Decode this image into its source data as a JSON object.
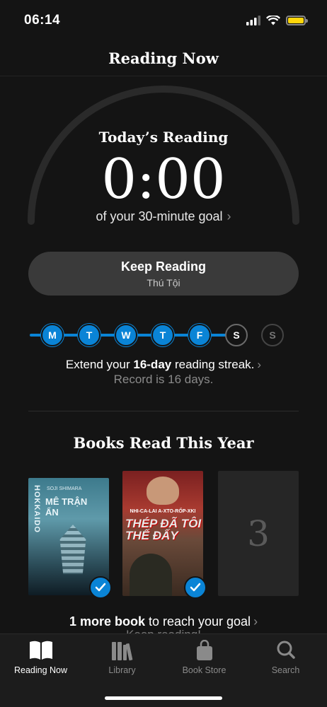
{
  "status": {
    "time": "06:14"
  },
  "header": {
    "title": "Reading Now"
  },
  "goal": {
    "label": "Today’s Reading",
    "time": "0:00",
    "subtitle": "of your 30-minute goal",
    "progress": 0
  },
  "keep_reading": {
    "title": "Keep Reading",
    "book": "Thú Tội"
  },
  "streak": {
    "days": [
      {
        "letter": "M",
        "state": "done"
      },
      {
        "letter": "T",
        "state": "done"
      },
      {
        "letter": "W",
        "state": "done"
      },
      {
        "letter": "T",
        "state": "done"
      },
      {
        "letter": "F",
        "state": "done"
      },
      {
        "letter": "S",
        "state": "today"
      },
      {
        "letter": "S",
        "state": "future"
      }
    ],
    "text_prefix": "Extend your ",
    "text_bold": "16-day",
    "text_suffix": " reading streak.",
    "record": "Record is 16 days."
  },
  "books_read": {
    "title": "Books Read This Year",
    "book1": {
      "spine": "HOKKAIDO",
      "author": "SOJI SHIMARA",
      "title": "MÊ TRẬN ẨN",
      "completed": true
    },
    "book2": {
      "author": "NHI-CA-LAI A-XTO-RỐP-XKI",
      "title": "THÉP ĐÃ TÔI THẾ ĐẤY",
      "completed": true
    },
    "book3": {
      "number": "3"
    },
    "remaining_bold": "1 more book",
    "remaining_suffix": " to reach your goal",
    "remaining_sub": "Keep reading!"
  },
  "tabs": [
    {
      "label": "Reading Now",
      "icon": "book-open-icon",
      "active": true
    },
    {
      "label": "Library",
      "icon": "library-books-icon",
      "active": false
    },
    {
      "label": "Book Store",
      "icon": "shopping-bag-icon",
      "active": false
    },
    {
      "label": "Search",
      "icon": "search-icon",
      "active": false
    }
  ],
  "colors": {
    "accent": "#0a84d6",
    "background": "#141414",
    "battery": "#ffd60a"
  }
}
